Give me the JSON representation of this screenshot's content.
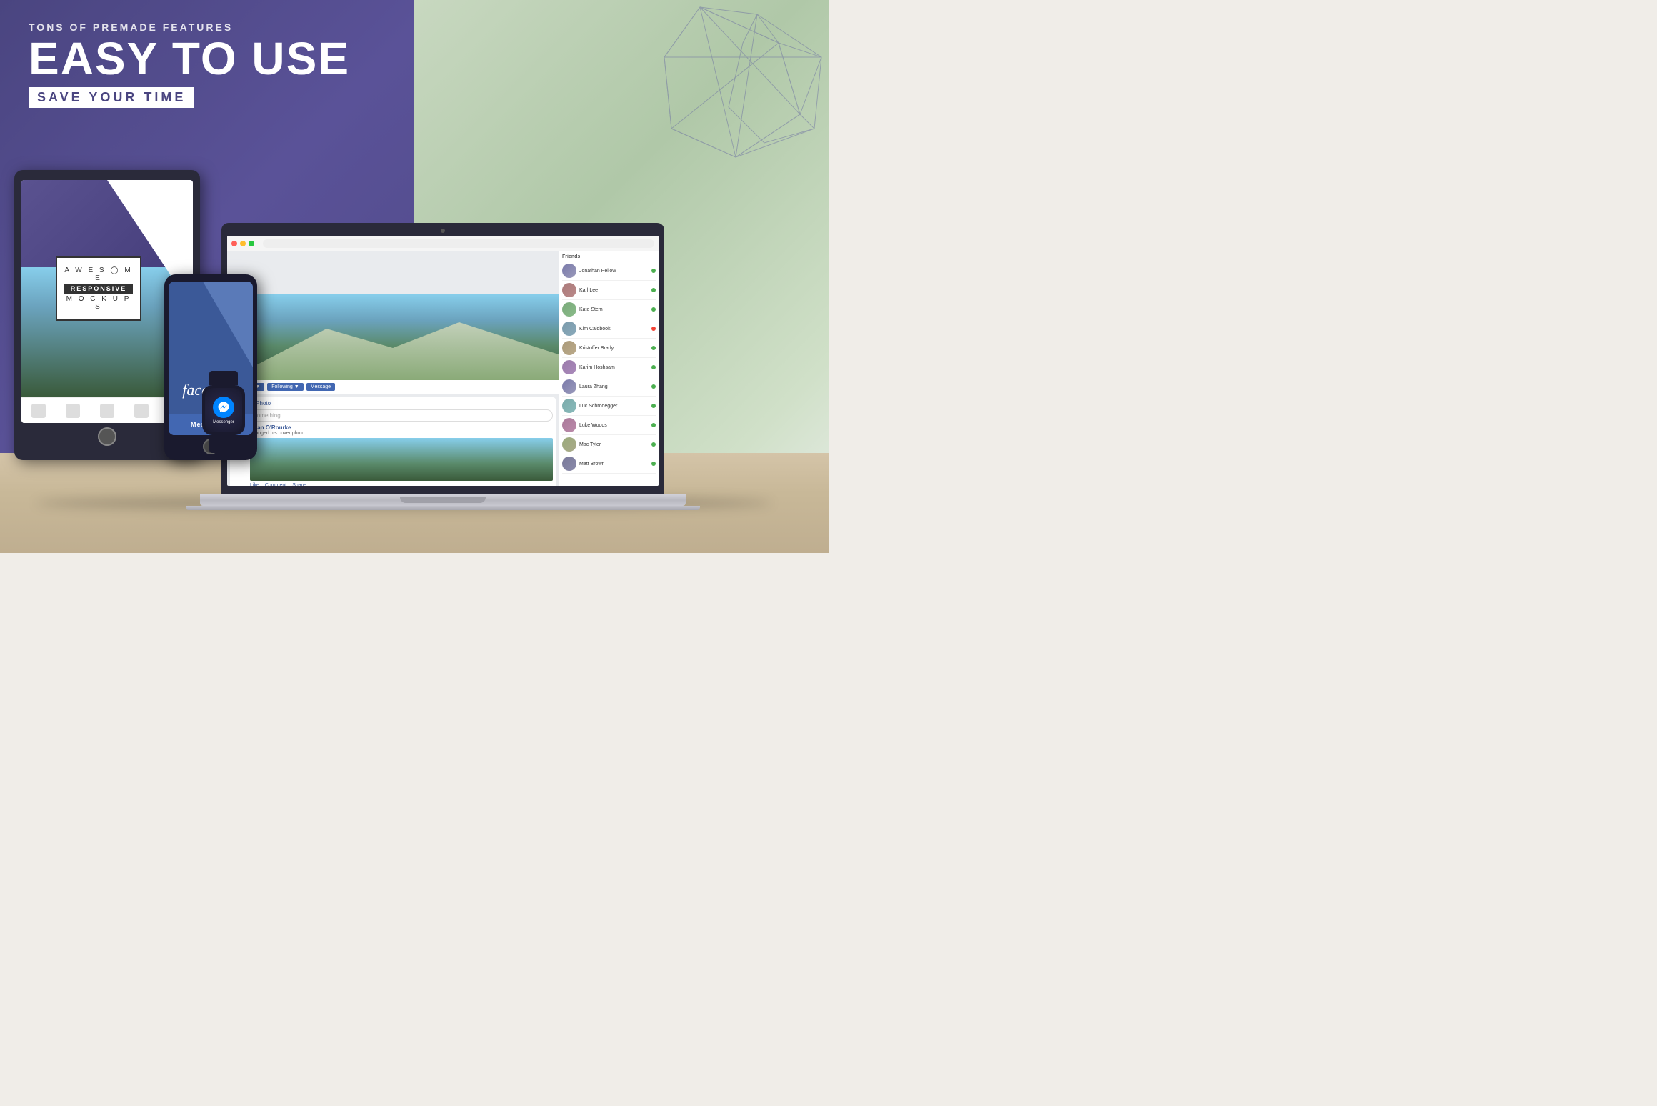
{
  "background": {
    "left_color_start": "#4a4580",
    "left_color_end": "#5a5298",
    "right_color": "#c8d8c0",
    "table_color": "#d4c4a8"
  },
  "headline": {
    "subtitle": "TONS OF PREMADE FEATURES",
    "main_title": "EASY TO USE",
    "badge": "SAVE YOUR TIME"
  },
  "tablet": {
    "logo_line1": "AWESOME",
    "logo_line2": "RESPONSIVE",
    "logo_line3": "MOCKUPS"
  },
  "phone": {
    "app_name": "facebook"
  },
  "watch": {
    "app_name": "Messenger"
  },
  "laptop": {
    "fb_write_placeholder": "Write something...",
    "fb_post_author": "Ryan O'Rourke",
    "fb_post_action": "changed his cover photo."
  },
  "sidebar_names": [
    "Jonathan Pellow",
    "Karl Lee",
    "Kate Stem",
    "Kim Caldbook",
    "Kristoffer Brady",
    "Karim Hoshsam",
    "Laura Zhang",
    "Luc Schrodegger",
    "Luke Woods",
    "Mac Tyler",
    "Matt Brown"
  ]
}
